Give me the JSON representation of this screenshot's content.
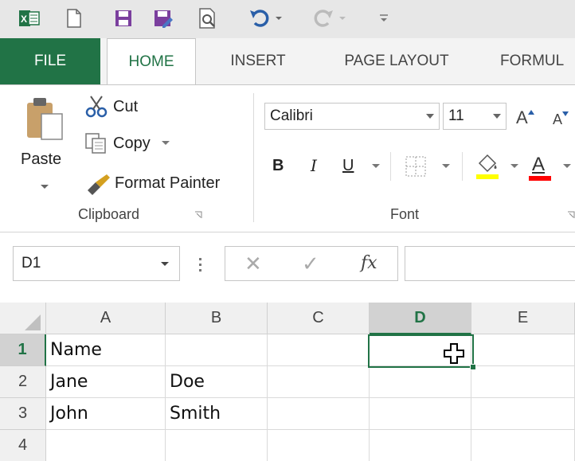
{
  "quick_access": {
    "excel_icon": "excel-logo-icon",
    "new_icon": "new-document-icon",
    "save_icon": "save-icon",
    "save_as_icon": "save-as-icon",
    "print_preview_icon": "print-preview-icon",
    "undo_icon": "undo-icon",
    "redo_icon": "redo-icon",
    "customize_icon": "customize-qat-icon"
  },
  "tabs": [
    {
      "label": "FILE"
    },
    {
      "label": "HOME"
    },
    {
      "label": "INSERT"
    },
    {
      "label": "PAGE LAYOUT"
    },
    {
      "label": "FORMUL"
    }
  ],
  "clipboard": {
    "paste_label": "Paste",
    "cut_label": "Cut",
    "copy_label": "Copy",
    "format_painter_label": "Format Painter",
    "group_label": "Clipboard"
  },
  "font": {
    "font_name": "Calibri",
    "font_size": "11",
    "bold_label": "B",
    "italic_label": "I",
    "underline_label": "U",
    "font_color_label": "A",
    "grow_label": "A",
    "shrink_label": "A",
    "group_label": "Font",
    "highlight_color": "#ffff00",
    "font_color": "#ff0000"
  },
  "formula_bar": {
    "name_box": "D1",
    "cancel_glyph": "✕",
    "enter_glyph": "✓",
    "fx_label": "fx",
    "formula_value": ""
  },
  "sheet": {
    "columns": [
      "A",
      "B",
      "C",
      "D",
      "E"
    ],
    "rows": [
      {
        "num": "1",
        "cells": [
          "Name",
          "",
          "",
          "",
          ""
        ]
      },
      {
        "num": "2",
        "cells": [
          "Jane",
          "Doe",
          "",
          "",
          ""
        ]
      },
      {
        "num": "3",
        "cells": [
          "John",
          "Smith",
          "",
          "",
          ""
        ]
      },
      {
        "num": "4",
        "cells": [
          "",
          "",
          "",
          "",
          ""
        ]
      }
    ],
    "selected_column": "D",
    "selected_row": "1",
    "accent": "#217346"
  }
}
